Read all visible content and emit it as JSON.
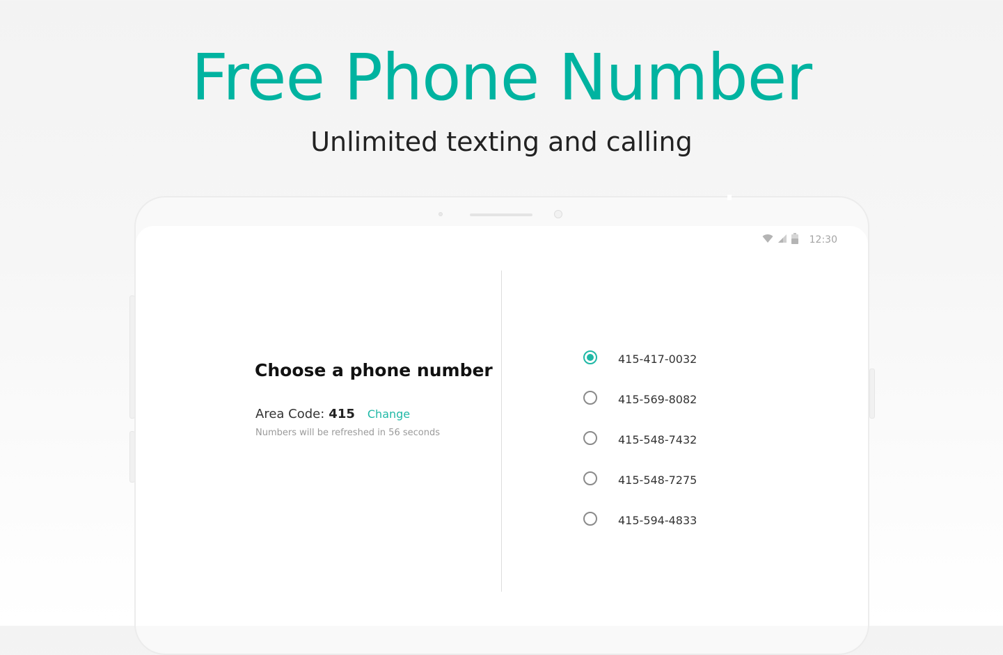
{
  "promo": {
    "headline": "Free Phone Number",
    "subheadline": "Unlimited texting and calling"
  },
  "status_bar": {
    "time": "12:30",
    "icons": [
      "wifi-icon",
      "signal-icon",
      "battery-icon"
    ]
  },
  "picker": {
    "title": "Choose a phone number",
    "area_code_label": "Area Code:",
    "area_code_value": "415",
    "change_label": "Change",
    "refresh_note": "Numbers will be refreshed in 56 seconds"
  },
  "numbers": [
    {
      "number": "415-417-0032",
      "selected": true
    },
    {
      "number": "415-569-8082",
      "selected": false
    },
    {
      "number": "415-548-7432",
      "selected": false
    },
    {
      "number": "415-548-7275",
      "selected": false
    },
    {
      "number": "415-594-4833",
      "selected": false
    }
  ],
  "colors": {
    "accent": "#00b3a0",
    "radio_selected": "#1fb8a6",
    "radio_unselected": "#8a8a8a"
  }
}
